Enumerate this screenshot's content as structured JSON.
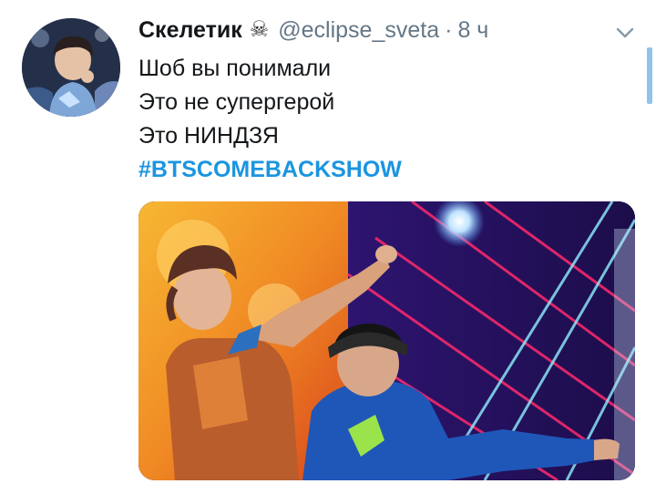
{
  "tweet": {
    "author": {
      "display_name": "Скелетик",
      "name_emoji": "☠",
      "handle": "@eclipse_sveta",
      "avatar_icon": "user-avatar"
    },
    "separator": "·",
    "time": "8 ч",
    "menu_icon": "chevron-down-icon",
    "text_lines": [
      "Шоб вы понимали",
      "Это не супергерой",
      "Это НИНДЗЯ"
    ],
    "hashtag": "#BTSCOMEBACKSHOW",
    "media_icon": "photo-two-performers-on-stage"
  },
  "colors": {
    "link": "#1b95e0",
    "secondary_text": "#657786",
    "primary_text": "#14171a",
    "scrollbar": "#8fc3ee"
  }
}
